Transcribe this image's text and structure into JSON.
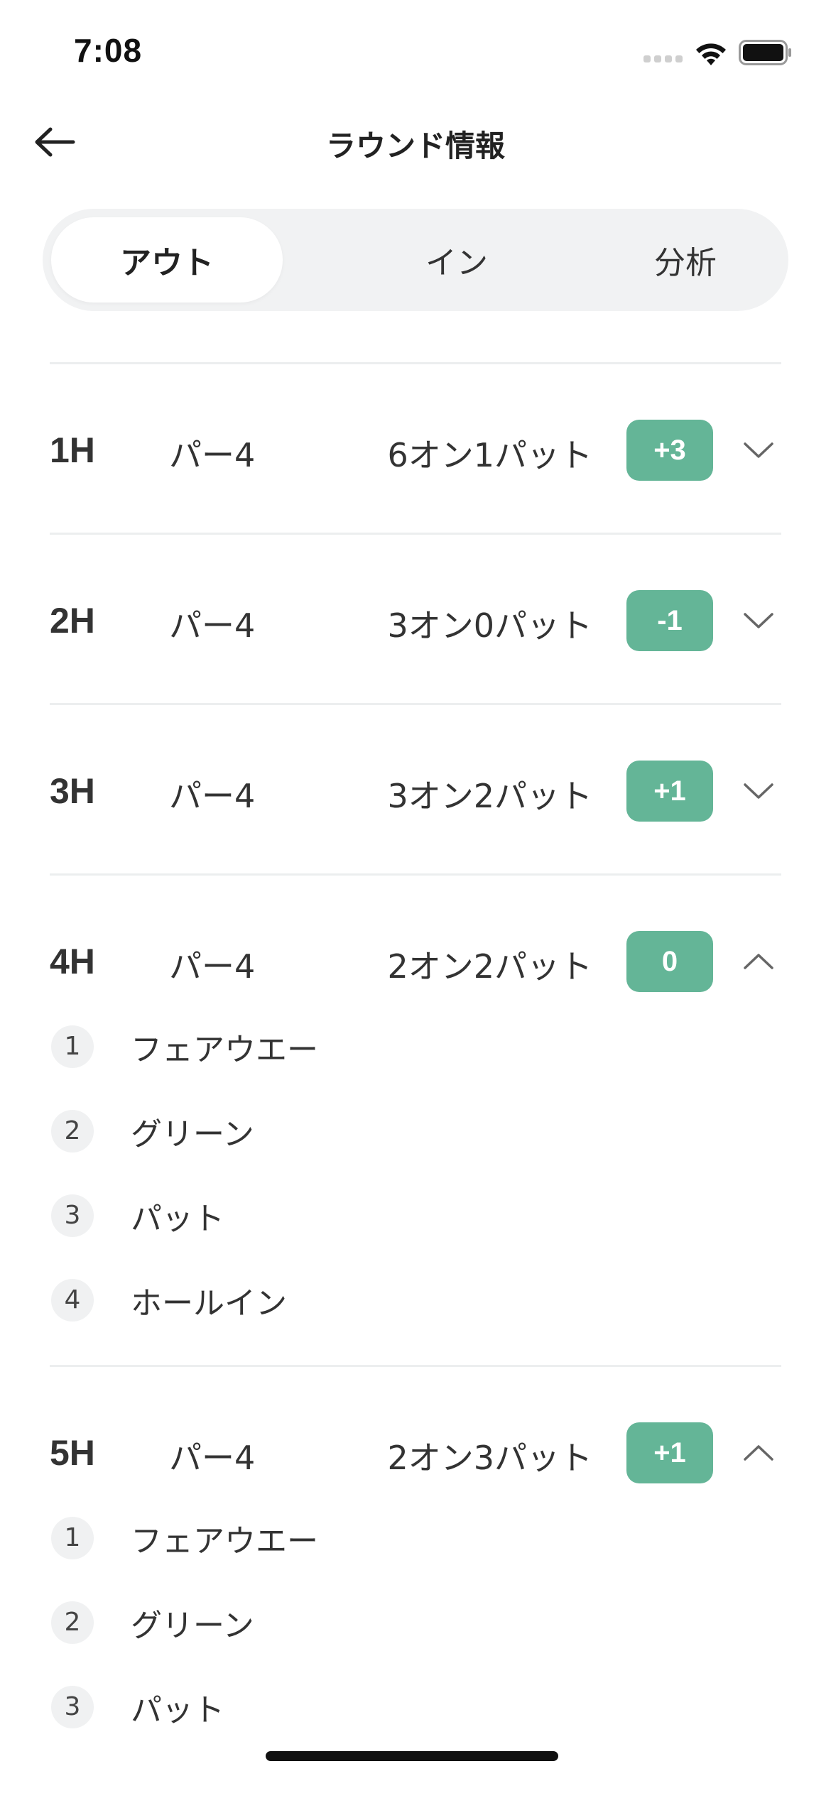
{
  "status_bar": {
    "time": "7:08"
  },
  "header": {
    "title": "ラウンド情報"
  },
  "tabs": [
    {
      "label": "アウト",
      "active": true
    },
    {
      "label": "イン",
      "active": false
    },
    {
      "label": "分析",
      "active": false
    }
  ],
  "holes": [
    {
      "hole": "1H",
      "par": "パー4",
      "result": "6オン1パット",
      "score": "+3",
      "expanded": false
    },
    {
      "hole": "2H",
      "par": "パー4",
      "result": "3オン0パット",
      "score": "-1",
      "expanded": false
    },
    {
      "hole": "3H",
      "par": "パー4",
      "result": "3オン2パット",
      "score": "+1",
      "expanded": false
    },
    {
      "hole": "4H",
      "par": "パー4",
      "result": "2オン2パット",
      "score": "0",
      "expanded": true,
      "shots": [
        {
          "num": "1",
          "label": "フェアウエー"
        },
        {
          "num": "2",
          "label": "グリーン"
        },
        {
          "num": "3",
          "label": "パット"
        },
        {
          "num": "4",
          "label": "ホールイン"
        }
      ]
    },
    {
      "hole": "5H",
      "par": "パー4",
      "result": "2オン3パット",
      "score": "+1",
      "expanded": true,
      "shots": [
        {
          "num": "1",
          "label": "フェアウエー"
        },
        {
          "num": "2",
          "label": "グリーン"
        },
        {
          "num": "3",
          "label": "パット"
        }
      ]
    }
  ],
  "colors": {
    "badge": "#64b597",
    "segment_bg": "#f1f2f3",
    "divider": "#eceeef"
  },
  "icons": {
    "back": "arrow-left-icon",
    "collapsed": "chevron-down-icon",
    "expanded": "chevron-up-icon"
  }
}
